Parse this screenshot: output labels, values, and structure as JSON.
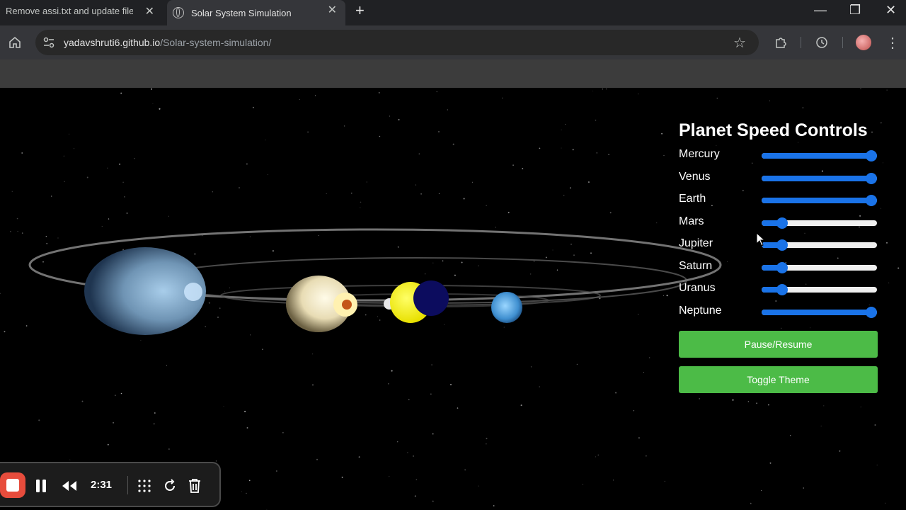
{
  "browser": {
    "tabs": [
      {
        "title": "Remove assi.txt and update file",
        "active": false
      },
      {
        "title": "Solar System Simulation",
        "active": true
      }
    ],
    "url_host": "yadavshruti6.github.io",
    "url_path": "/Solar-system-simulation/",
    "icons": {
      "close": "✕",
      "new_tab": "+",
      "minimize": "—",
      "restore": "❐",
      "window_close": "✕",
      "home": "home-icon",
      "site_info": "tune-icon",
      "star": "☆",
      "extensions": "puzzle-icon",
      "history": "history-icon",
      "menu": "⋮"
    }
  },
  "controls": {
    "title": "Planet Speed Controls",
    "planets": [
      {
        "name": "Mercury",
        "level": 1.0
      },
      {
        "name": "Venus",
        "level": 1.0
      },
      {
        "name": "Earth",
        "level": 1.0
      },
      {
        "name": "Mars",
        "level": 0.14
      },
      {
        "name": "Jupiter",
        "level": 0.14
      },
      {
        "name": "Saturn",
        "level": 0.14
      },
      {
        "name": "Uranus",
        "level": 0.14
      },
      {
        "name": "Neptune",
        "level": 1.0
      }
    ],
    "pause_label": "Pause/Resume",
    "theme_label": "Toggle Theme",
    "accent_color": "#1a73e8",
    "button_color": "#4cbb47"
  },
  "recorder": {
    "time": "2:31",
    "stop_color": "#e74c3c"
  }
}
